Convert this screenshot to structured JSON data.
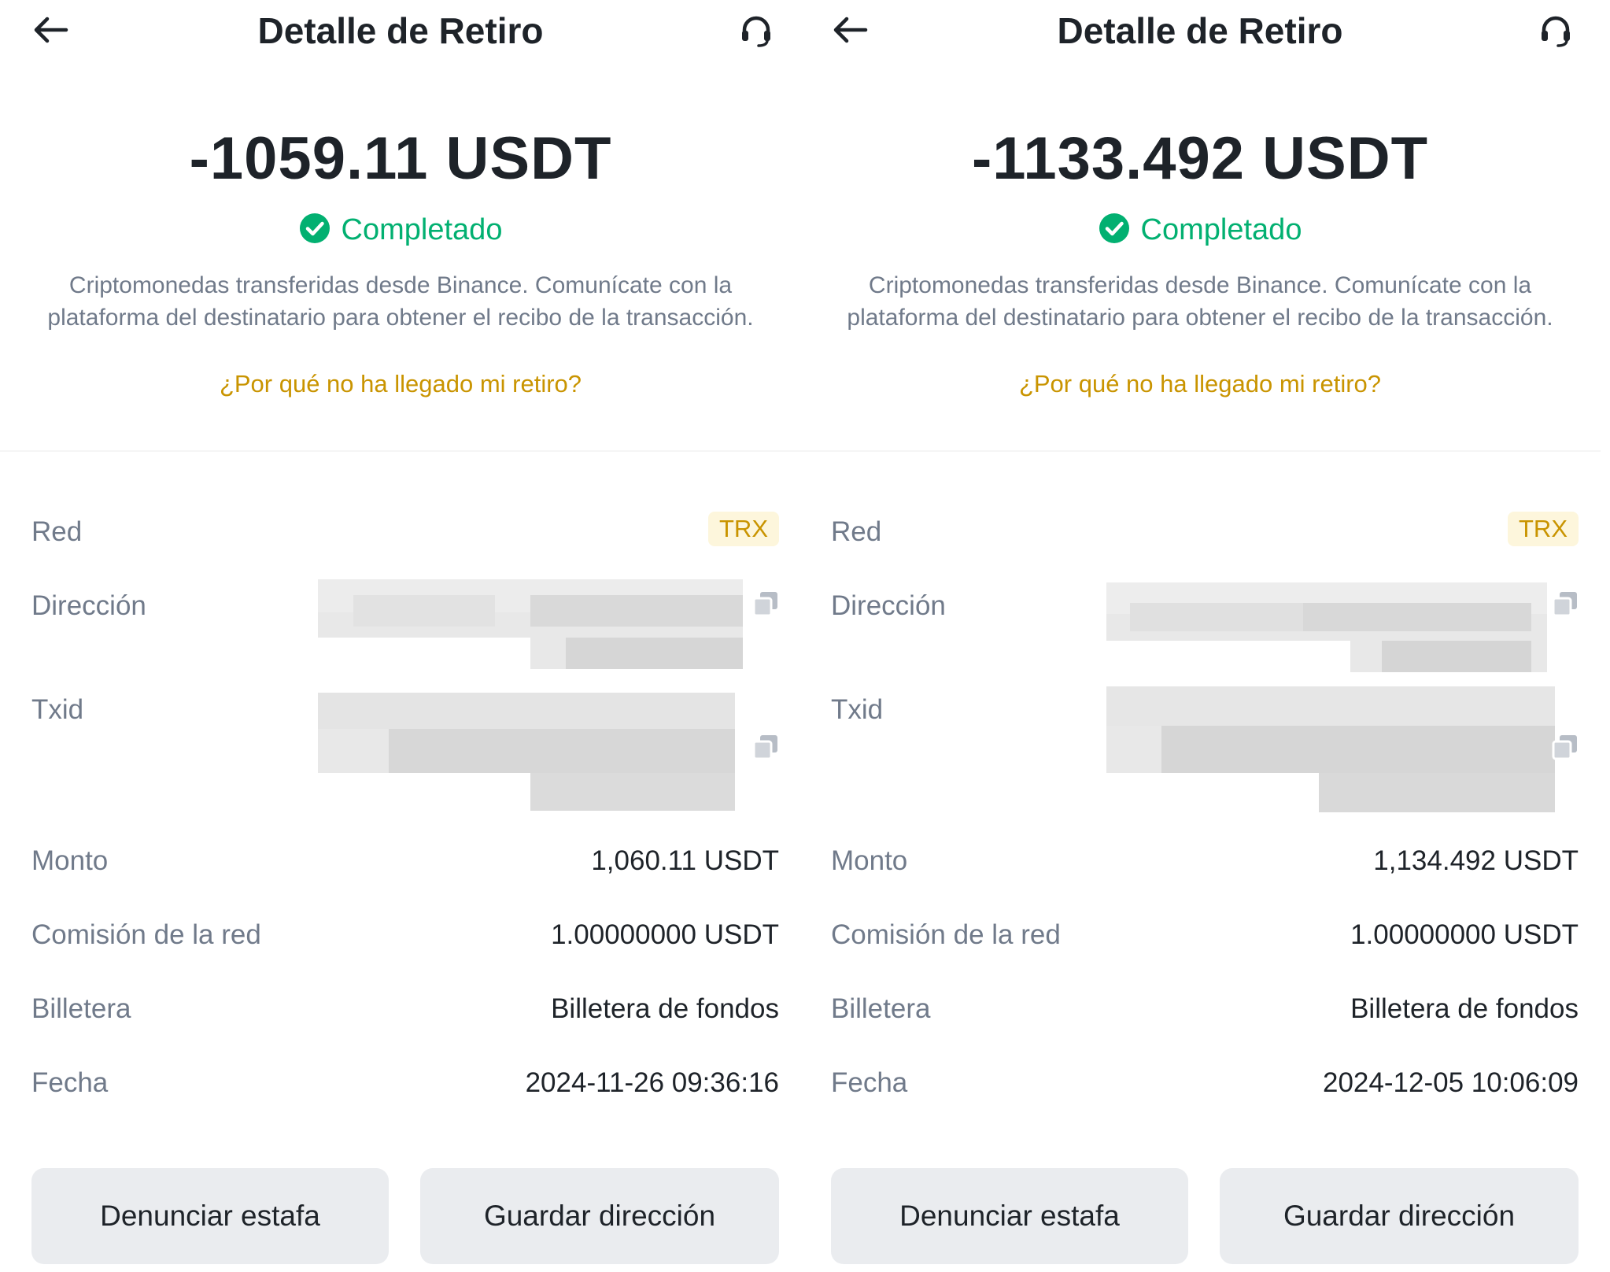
{
  "panels": [
    {
      "title": "Detalle de Retiro",
      "amount": "-1059.11 USDT",
      "status": "Completado",
      "description": "Criptomonedas transferidas desde Binance. Comunícate con la plataforma del destinatario para obtener el recibo de la transacción.",
      "help_link": "¿Por qué no ha llegado mi retiro?",
      "details": {
        "network_label": "Red",
        "network_value": "TRX",
        "address_label": "Dirección",
        "txid_label": "Txid",
        "amount_label": "Monto",
        "amount_value": "1,060.11 USDT",
        "fee_label": "Comisión de la red",
        "fee_value": "1.00000000 USDT",
        "wallet_label": "Billetera",
        "wallet_value": "Billetera de fondos",
        "date_label": "Fecha",
        "date_value": "2024-11-26 09:36:16"
      },
      "buttons": {
        "report": "Denunciar estafa",
        "save_address": "Guardar dirección"
      }
    },
    {
      "title": "Detalle de Retiro",
      "amount": "-1133.492 USDT",
      "status": "Completado",
      "description": "Criptomonedas transferidas desde Binance. Comunícate con la plataforma del destinatario para obtener el recibo de la transacción.",
      "help_link": "¿Por qué no ha llegado mi retiro?",
      "details": {
        "network_label": "Red",
        "network_value": "TRX",
        "address_label": "Dirección",
        "txid_label": "Txid",
        "amount_label": "Monto",
        "amount_value": "1,134.492 USDT",
        "fee_label": "Comisión de la red",
        "fee_value": "1.00000000 USDT",
        "wallet_label": "Billetera",
        "wallet_value": "Billetera de fondos",
        "date_label": "Fecha",
        "date_value": "2024-12-05 10:06:09"
      },
      "buttons": {
        "report": "Denunciar estafa",
        "save_address": "Guardar dirección"
      }
    }
  ],
  "icons": {
    "back": "arrow-left-icon",
    "support": "headset-icon",
    "status": "check-circle-icon",
    "copy": "copy-icon"
  },
  "colors": {
    "text_primary": "#1e2329",
    "text_secondary": "#707a8a",
    "success": "#02b071",
    "link": "#c99400",
    "badge_bg": "#fdf6dc",
    "button_bg": "#eaecef"
  }
}
